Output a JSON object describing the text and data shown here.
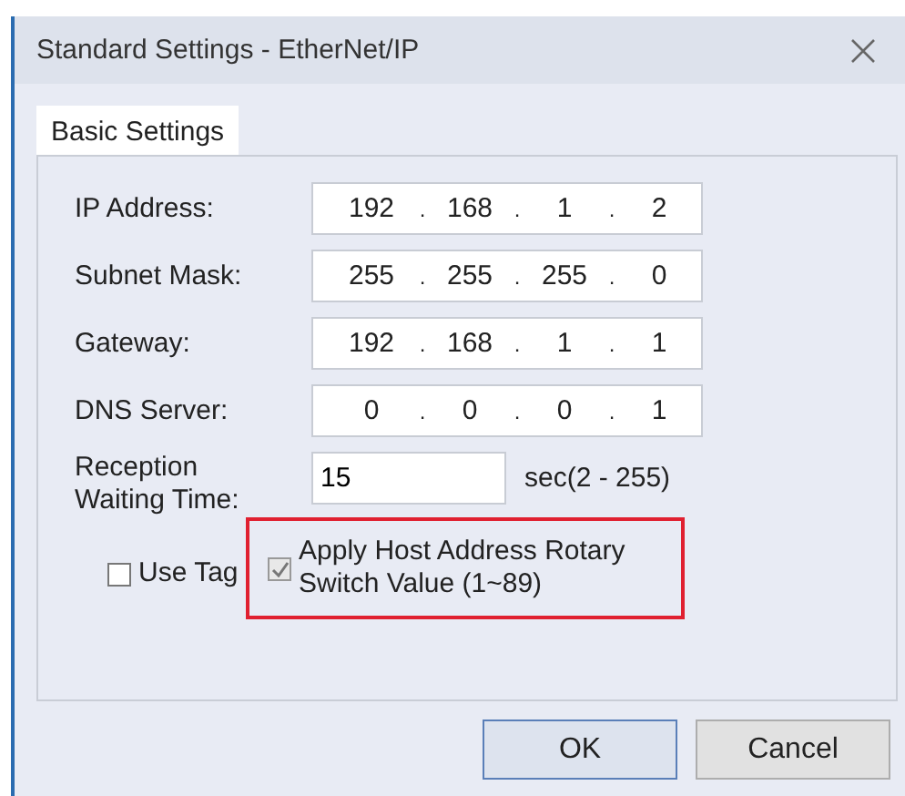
{
  "window": {
    "title": "Standard Settings - EtherNet/IP"
  },
  "tabs": [
    {
      "label": "Basic Settings",
      "selected": true
    }
  ],
  "address_fields": [
    {
      "label": "IP Address:",
      "segments": [
        "192",
        ".",
        "168",
        ".",
        "1",
        ".",
        "2"
      ]
    },
    {
      "label": "Subnet Mask:",
      "segments": [
        "255",
        ".",
        "255",
        ".",
        "255",
        ".",
        "0"
      ]
    },
    {
      "label": "Gateway:",
      "segments": [
        "192",
        ".",
        "168",
        ".",
        "1",
        ".",
        "1"
      ]
    },
    {
      "label": "DNS Server:",
      "segments": [
        "0",
        ".",
        "0",
        ".",
        "0",
        ".",
        "1"
      ]
    }
  ],
  "reception": {
    "label": "Reception Waiting Time:",
    "value": "15",
    "unit": "sec(2 - 255)"
  },
  "checkboxes": [
    {
      "label": "Use Tag",
      "checked": false,
      "highlighted": false
    },
    {
      "label": "Apply Host Address Rotary Switch Value (1~89)",
      "checked": true,
      "highlighted": true
    }
  ],
  "buttons": [
    {
      "label": "OK",
      "default": true
    },
    {
      "label": "Cancel",
      "default": false
    }
  ]
}
